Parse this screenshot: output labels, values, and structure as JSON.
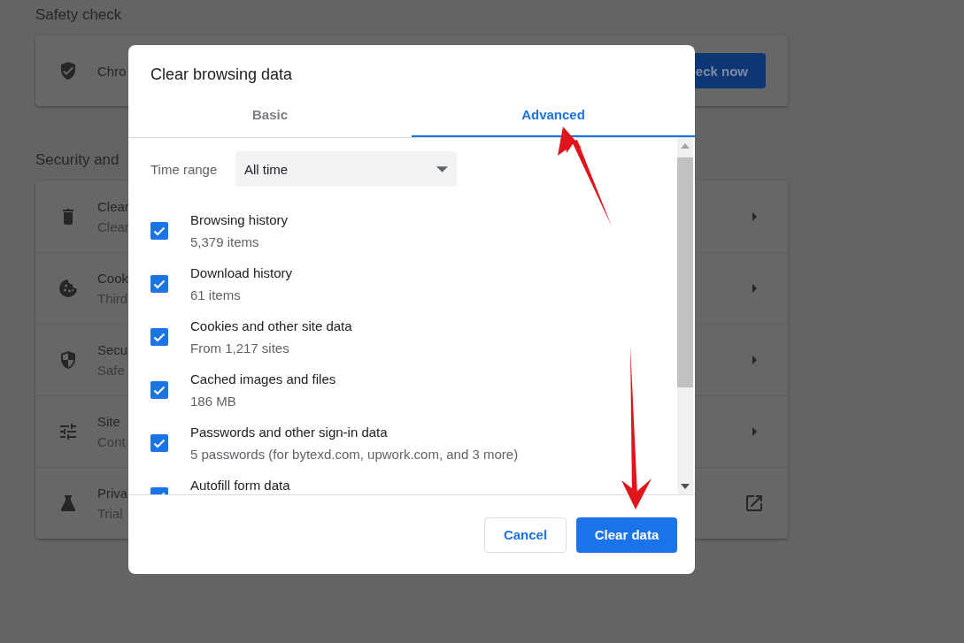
{
  "background": {
    "safety_check": {
      "title": "Safety check",
      "row_text": "Chro",
      "button": "eck now"
    },
    "security": {
      "title": "Security and",
      "rows": [
        {
          "kind": "submenu",
          "title": "Clear",
          "subtitle": "Clear"
        },
        {
          "kind": "submenu",
          "title": "Cook",
          "subtitle": "Third"
        },
        {
          "kind": "submenu",
          "title": "Secu",
          "subtitle": "Safe"
        },
        {
          "kind": "submenu",
          "title": "Site",
          "subtitle": "Cont"
        },
        {
          "kind": "external",
          "title": "Priva",
          "subtitle": "Trial"
        }
      ]
    }
  },
  "dialog": {
    "title": "Clear browsing data",
    "tabs": [
      {
        "label": "Basic",
        "selected": false
      },
      {
        "label": "Advanced",
        "selected": true
      }
    ],
    "time_range": {
      "label": "Time range",
      "value": "All time"
    },
    "items": [
      {
        "label": "Browsing history",
        "detail": "5,379 items",
        "checked": true
      },
      {
        "label": "Download history",
        "detail": "61 items",
        "checked": true
      },
      {
        "label": "Cookies and other site data",
        "detail": "From 1,217 sites",
        "checked": true
      },
      {
        "label": "Cached images and files",
        "detail": "186 MB",
        "checked": true
      },
      {
        "label": "Passwords and other sign-in data",
        "detail": "5 passwords (for bytexd.com, upwork.com, and 3 more)",
        "checked": true
      },
      {
        "label": "Autofill form data",
        "checked": true
      }
    ],
    "buttons": [
      {
        "label": "Cancel",
        "kind": "secondary"
      },
      {
        "label": "Clear data",
        "kind": "primary"
      }
    ]
  }
}
